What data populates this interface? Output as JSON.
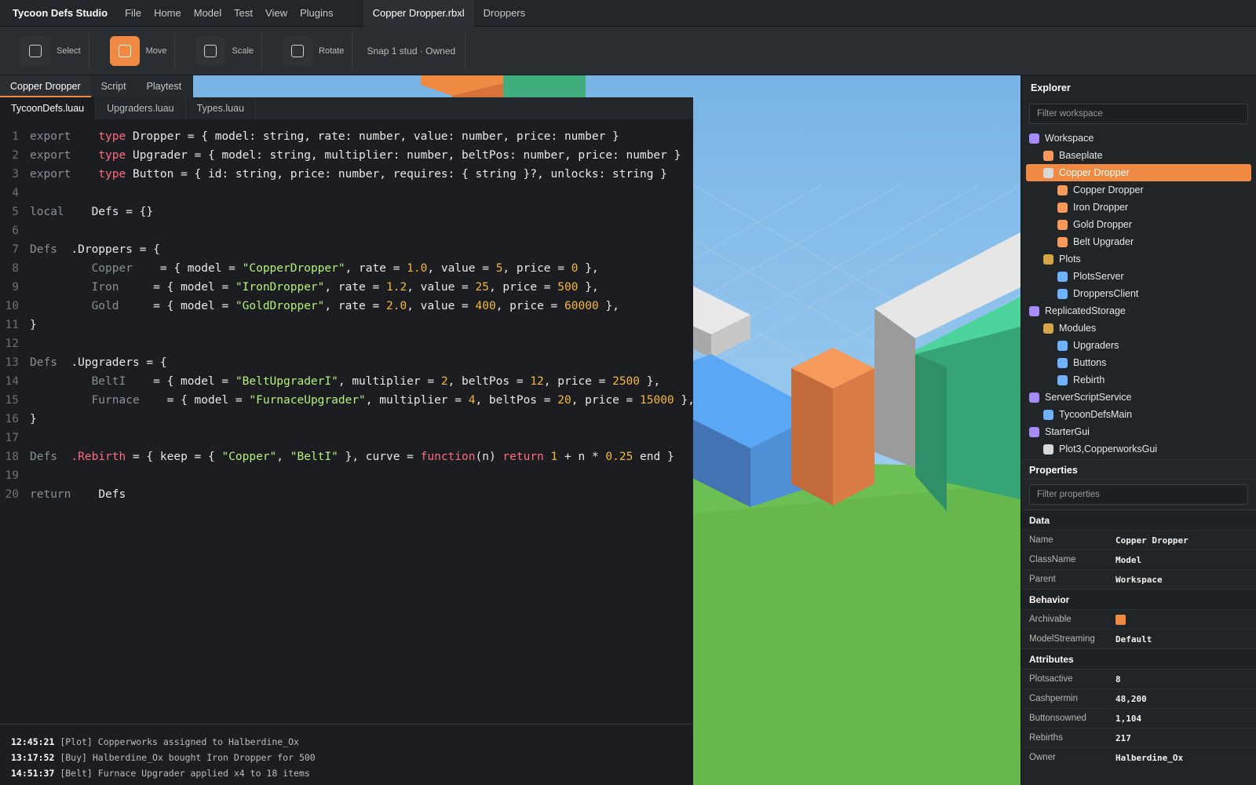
{
  "menubar": {
    "app_title": "Tycoon Defs Studio",
    "menus": [
      "File",
      "Home",
      "Model",
      "Test",
      "View",
      "Plugins"
    ],
    "doc_tabs": [
      "Copper Dropper.rbxl",
      "Droppers"
    ]
  },
  "toolbar": {
    "tools": [
      {
        "label": "Select",
        "active": false
      },
      {
        "label": "Move",
        "active": true
      },
      {
        "label": "Scale",
        "active": false
      },
      {
        "label": "Rotate",
        "active": false
      }
    ],
    "snap_text": "Snap 1 stud · Owned"
  },
  "editor": {
    "top_tabs": [
      "Copper Dropper",
      "Script",
      "Playtest"
    ],
    "file_tabs": [
      "TycoonDefs.luau",
      "Upgraders.luau",
      "Types.luau"
    ],
    "lines": [
      [
        [
          "tok-local",
          "export    "
        ],
        [
          "tok-kw",
          "type"
        ],
        [
          "tok-id",
          " Dropper = { model: string, rate: number, value: number, price: number }"
        ]
      ],
      [
        [
          "tok-local",
          "export    "
        ],
        [
          "tok-kw",
          "type"
        ],
        [
          "tok-id",
          " Upgrader = { model: string, multiplier: number, beltPos: number, price: number }"
        ]
      ],
      [
        [
          "tok-local",
          "export    "
        ],
        [
          "tok-kw",
          "type"
        ],
        [
          "tok-id",
          " Button = { id: string, price: number, requires: { string }?, unlocks: string }"
        ]
      ],
      [],
      [
        [
          "tok-local",
          "local    "
        ],
        [
          "tok-id",
          "Defs = {}"
        ]
      ],
      [],
      [
        [
          "tok-local",
          "Defs  "
        ],
        [
          "tok-id",
          ".Droppers = {"
        ]
      ],
      [
        [
          "tok-dim",
          "         Copper   "
        ],
        [
          "tok-id",
          " = { model = "
        ],
        [
          "tok-str",
          "\"CopperDropper\""
        ],
        [
          "tok-id",
          ", rate = "
        ],
        [
          "tok-num",
          "1.0"
        ],
        [
          "tok-id",
          ", value = "
        ],
        [
          "tok-num",
          "5"
        ],
        [
          "tok-id",
          ", price = "
        ],
        [
          "tok-num",
          "0"
        ],
        [
          "tok-id",
          " },"
        ]
      ],
      [
        [
          "tok-dim",
          "         Iron   "
        ],
        [
          "tok-id",
          "  = { model = "
        ],
        [
          "tok-str",
          "\"IronDropper\""
        ],
        [
          "tok-id",
          ", rate = "
        ],
        [
          "tok-num",
          "1.2"
        ],
        [
          "tok-id",
          ", value = "
        ],
        [
          "tok-num",
          "25"
        ],
        [
          "tok-id",
          ", price = "
        ],
        [
          "tok-num",
          "500"
        ],
        [
          "tok-id",
          " },"
        ]
      ],
      [
        [
          "tok-dim",
          "         Gold   "
        ],
        [
          "tok-id",
          "  = { model = "
        ],
        [
          "tok-str",
          "\"GoldDropper\""
        ],
        [
          "tok-id",
          ", rate = "
        ],
        [
          "tok-num",
          "2.0"
        ],
        [
          "tok-id",
          ", value = "
        ],
        [
          "tok-num",
          "400"
        ],
        [
          "tok-id",
          ", price = "
        ],
        [
          "tok-num",
          "60000"
        ],
        [
          "tok-id",
          " },"
        ]
      ],
      [
        [
          "tok-id",
          "}"
        ]
      ],
      [],
      [
        [
          "tok-local",
          "Defs  "
        ],
        [
          "tok-id",
          ".Upgraders = {"
        ]
      ],
      [
        [
          "tok-dim",
          "         BeltI   "
        ],
        [
          "tok-id",
          " = { model = "
        ],
        [
          "tok-str",
          "\"BeltUpgraderI\""
        ],
        [
          "tok-id",
          ", multiplier = "
        ],
        [
          "tok-num",
          "2"
        ],
        [
          "tok-id",
          ", beltPos = "
        ],
        [
          "tok-num",
          "12"
        ],
        [
          "tok-id",
          ", price = "
        ],
        [
          "tok-num",
          "2500"
        ],
        [
          "tok-id",
          " },"
        ]
      ],
      [
        [
          "tok-dim",
          "         Furnace   "
        ],
        [
          "tok-id",
          " = { model = "
        ],
        [
          "tok-str",
          "\"FurnaceUpgrader\""
        ],
        [
          "tok-id",
          ", multiplier = "
        ],
        [
          "tok-num",
          "4"
        ],
        [
          "tok-id",
          ", beltPos = "
        ],
        [
          "tok-num",
          "20"
        ],
        [
          "tok-id",
          ", price = "
        ],
        [
          "tok-num",
          "15000"
        ],
        [
          "tok-id",
          " },"
        ]
      ],
      [
        [
          "tok-id",
          "}"
        ]
      ],
      [],
      [
        [
          "tok-local",
          "Defs  "
        ],
        [
          "tok-kw",
          ".Rebirth"
        ],
        [
          "tok-id",
          " = { keep = { "
        ],
        [
          "tok-str",
          "\"Copper\""
        ],
        [
          "tok-id",
          ", "
        ],
        [
          "tok-str",
          "\"BeltI\""
        ],
        [
          "tok-id",
          " }, curve = "
        ],
        [
          "tok-kw",
          "function"
        ],
        [
          "tok-id",
          "(n) "
        ],
        [
          "tok-kw",
          "return"
        ],
        [
          "tok-id",
          " "
        ],
        [
          "tok-num",
          "1"
        ],
        [
          "tok-id",
          " + n * "
        ],
        [
          "tok-num",
          "0.25"
        ],
        [
          "tok-id",
          " end }"
        ]
      ],
      [],
      [
        [
          "tok-local",
          "return    "
        ],
        [
          "tok-id",
          "Defs"
        ]
      ]
    ],
    "console": [
      {
        "time": "12:45:21",
        "msg": " [Plot] Copperworks assigned to Halberdine_Ox"
      },
      {
        "time": "13:17:52",
        "msg": " [Buy] Halberdine_Ox bought Iron Dropper for 500"
      },
      {
        "time": "14:51:37",
        "msg": " [Belt] Furnace Upgrader applied x4 to 18 items"
      }
    ]
  },
  "explorer": {
    "title": "Explorer",
    "filter_placeholder": "Filter workspace",
    "items": [
      {
        "label": "Workspace",
        "depth": 0,
        "color": "#a78bfa",
        "selected": false
      },
      {
        "label": "Baseplate",
        "depth": 1,
        "color": "#f59a5a",
        "selected": false
      },
      {
        "label": "Copper Dropper",
        "depth": 1,
        "color": "#d8d8d8",
        "selected": true
      },
      {
        "label": "Copper Dropper",
        "depth": 2,
        "color": "#f59a5a",
        "selected": false
      },
      {
        "label": "Iron Dropper",
        "depth": 2,
        "color": "#f59a5a",
        "selected": false
      },
      {
        "label": "Gold Dropper",
        "depth": 2,
        "color": "#f59a5a",
        "selected": false
      },
      {
        "label": "Belt Upgrader",
        "depth": 2,
        "color": "#f59a5a",
        "selected": false
      },
      {
        "label": "Plots",
        "depth": 1,
        "color": "#d4a646",
        "selected": false
      },
      {
        "label": "PlotsServer",
        "depth": 2,
        "color": "#6fb3ff",
        "selected": false
      },
      {
        "label": "DroppersClient",
        "depth": 2,
        "color": "#6fb3ff",
        "selected": false
      },
      {
        "label": "ReplicatedStorage",
        "depth": 0,
        "color": "#a78bfa",
        "selected": false
      },
      {
        "label": "Modules",
        "depth": 1,
        "color": "#d4a646",
        "selected": false
      },
      {
        "label": "Upgraders",
        "depth": 2,
        "color": "#6fb3ff",
        "selected": false
      },
      {
        "label": "Buttons",
        "depth": 2,
        "color": "#6fb3ff",
        "selected": false
      },
      {
        "label": "Rebirth",
        "depth": 2,
        "color": "#6fb3ff",
        "selected": false
      },
      {
        "label": "ServerScriptService",
        "depth": 0,
        "color": "#a78bfa",
        "selected": false
      },
      {
        "label": "TycoonDefsMain",
        "depth": 1,
        "color": "#6fb3ff",
        "selected": false
      },
      {
        "label": "StarterGui",
        "depth": 0,
        "color": "#a78bfa",
        "selected": false
      },
      {
        "label": "Plot3,CopperworksGui",
        "depth": 1,
        "color": "#d8d8d8",
        "selected": false
      }
    ]
  },
  "properties": {
    "title": "Properties",
    "filter_placeholder": "Filter properties",
    "sections": [
      {
        "name": "Data",
        "rows": [
          {
            "key": "Name",
            "value": "Copper Dropper"
          },
          {
            "key": "ClassName",
            "value": "Model"
          },
          {
            "key": "Parent",
            "value": "Workspace"
          }
        ]
      },
      {
        "name": "Behavior",
        "rows": [
          {
            "key": "Archivable",
            "value": "",
            "swatch": true
          },
          {
            "key": "ModelStreaming",
            "value": "Default"
          }
        ]
      },
      {
        "name": "Attributes",
        "rows": [
          {
            "key": "Plotsactive",
            "value": "8"
          },
          {
            "key": "Cashpermin",
            "value": "48,200"
          },
          {
            "key": "Buttonsowned",
            "value": "1,104"
          },
          {
            "key": "Rebirths",
            "value": "217"
          },
          {
            "key": "Owner",
            "value": "Halberdine_Ox"
          }
        ]
      }
    ]
  },
  "colors": {
    "accent": "#f08a43",
    "sky": "#8cc3ec",
    "grass": "#6cbf52",
    "teal": "#3fc48f",
    "blue_block": "#5aa7f5"
  }
}
